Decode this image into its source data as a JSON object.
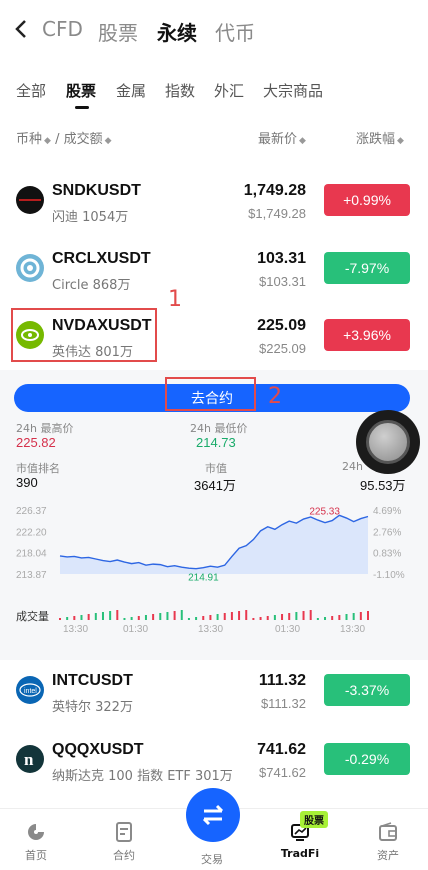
{
  "nav": {
    "back_icon": "chevron-left-icon",
    "tabs": [
      "CFD",
      "股票",
      "永续",
      "代币"
    ],
    "active_tab": "永续"
  },
  "categories": [
    "全部",
    "股票",
    "金属",
    "指数",
    "外汇",
    "大宗商品"
  ],
  "active_category": "股票",
  "header": {
    "col1": "币种",
    "col1b": "成交额",
    "col2": "最新价",
    "col3": "涨跌幅"
  },
  "rows_top": [
    {
      "symbol": "SNDKUSDT",
      "sub": "闪迪 1054万",
      "price": "1,749.28",
      "usd": "$1,749.28",
      "change": "+0.99%",
      "dir": "up"
    },
    {
      "symbol": "CRCLXUSDT",
      "sub": "Circle 868万",
      "price": "103.31",
      "usd": "$103.31",
      "change": "-7.97%",
      "dir": "down"
    },
    {
      "symbol": "NVDAXUSDT",
      "sub": "英伟达 801万",
      "price": "225.09",
      "usd": "$225.09",
      "change": "+3.96%",
      "dir": "up"
    }
  ],
  "panel": {
    "go_button": "去合约",
    "high_label": "24h 最高价",
    "high_value": "225.82",
    "low_label": "24h 最低价",
    "low_value": "214.73",
    "rank_label": "市值排名",
    "rank_value": "390",
    "mcap_label": "市值",
    "mcap_value": "3641万",
    "vol_label": "24h",
    "vol_value": "95.53万",
    "chart_volume_label": "成交量",
    "annotation_1": "1",
    "annotation_2": "2"
  },
  "chart_data": {
    "type": "line",
    "y_ticks_left": [
      "226.37",
      "222.20",
      "218.04",
      "213.87"
    ],
    "y_ticks_right": [
      "4.69%",
      "2.76%",
      "0.83%",
      "-1.10%"
    ],
    "x_ticks": [
      "13:30",
      "01:30",
      "13:30",
      "01:30",
      "13:30"
    ],
    "max_label": "225.33",
    "min_label": "214.91",
    "series": [
      {
        "values": [
          217.4,
          217.2,
          217.3,
          217.0,
          217.1,
          216.8,
          216.5,
          216.3,
          216.6,
          216.2,
          215.9,
          216.1,
          215.6,
          215.8,
          215.7,
          215.3,
          215.5,
          215.2,
          215.0,
          214.91,
          215.1,
          215.4,
          215.2,
          215.6,
          217.3,
          218.9,
          219.4,
          220.6,
          222.3,
          223.1,
          222.6,
          223.5,
          224.2,
          223.8,
          224.6,
          225.0,
          224.4,
          223.9,
          224.3,
          225.33,
          224.8,
          224.1,
          224.7,
          225.1
        ]
      }
    ]
  },
  "rows_bottom": [
    {
      "symbol": "INTCUSDT",
      "sub": "英特尔 322万",
      "price": "111.32",
      "usd": "$111.32",
      "change": "-3.37%",
      "dir": "down"
    },
    {
      "symbol": "QQQXUSDT",
      "sub": "纳斯达克 100 指数 ETF 301万",
      "price": "741.62",
      "usd": "$741.62",
      "change": "-0.29%",
      "dir": "down"
    }
  ],
  "bottom_nav": {
    "home": "首页",
    "contract": "合约",
    "trade": "交易",
    "tradfi": "TradFi",
    "tradfi_badge": "股票",
    "assets": "资产"
  },
  "colors": {
    "accent": "#1664ff",
    "up": "#e8384f",
    "down": "#28c07a"
  }
}
